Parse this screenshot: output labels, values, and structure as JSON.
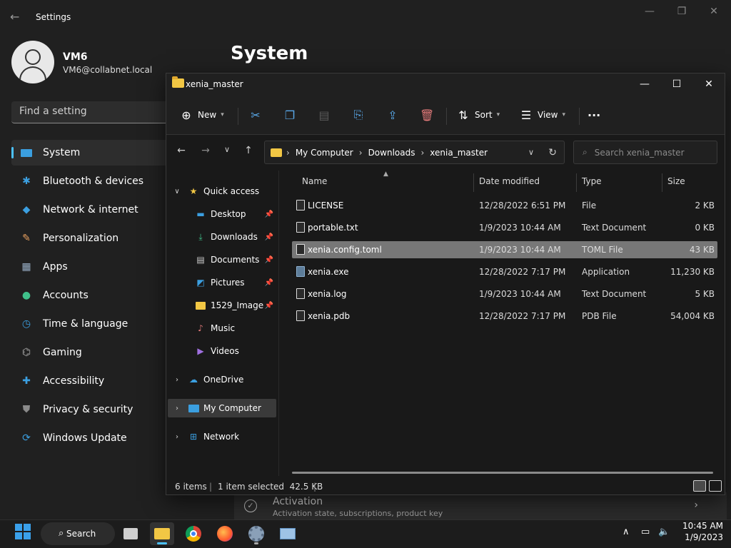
{
  "settings": {
    "title": "Settings",
    "user_name": "VM6",
    "user_email": "VM6@collabnet.local",
    "search_placeholder": "Find a setting",
    "heading": "System",
    "nav": [
      {
        "label": "System",
        "icon": "display-icon",
        "active": true
      },
      {
        "label": "Bluetooth & devices",
        "icon": "bluetooth-icon"
      },
      {
        "label": "Network & internet",
        "icon": "wifi-icon"
      },
      {
        "label": "Personalization",
        "icon": "brush-icon"
      },
      {
        "label": "Apps",
        "icon": "apps-icon"
      },
      {
        "label": "Accounts",
        "icon": "person-icon"
      },
      {
        "label": "Time & language",
        "icon": "clock-globe-icon"
      },
      {
        "label": "Gaming",
        "icon": "gamepad-icon"
      },
      {
        "label": "Accessibility",
        "icon": "accessibility-icon"
      },
      {
        "label": "Privacy & security",
        "icon": "shield-icon"
      },
      {
        "label": "Windows Update",
        "icon": "update-icon"
      }
    ],
    "activation": {
      "title": "Activation",
      "subtitle": "Activation state, subscriptions, product key"
    }
  },
  "explorer": {
    "title": "xenia_master",
    "toolbar": {
      "new_label": "New",
      "sort_label": "Sort",
      "view_label": "View",
      "more_label": "···"
    },
    "breadcrumb": [
      "My Computer",
      "Downloads",
      "xenia_master"
    ],
    "search_placeholder": "Search xenia_master",
    "tree": [
      {
        "label": "Quick access",
        "icon": "star-icon",
        "level": 0,
        "expanded": true
      },
      {
        "label": "Desktop",
        "icon": "desktop-icon",
        "level": 1,
        "pinned": true
      },
      {
        "label": "Downloads",
        "icon": "download-icon",
        "level": 1,
        "pinned": true
      },
      {
        "label": "Documents",
        "icon": "document-icon",
        "level": 1,
        "pinned": true
      },
      {
        "label": "Pictures",
        "icon": "pictures-icon",
        "level": 1,
        "pinned": true
      },
      {
        "label": "1529_Image",
        "icon": "folder-icon",
        "level": 1,
        "pinned": true
      },
      {
        "label": "Music",
        "icon": "music-icon",
        "level": 1
      },
      {
        "label": "Videos",
        "icon": "videos-icon",
        "level": 1
      },
      {
        "label": "OneDrive",
        "icon": "cloud-icon",
        "level": 0,
        "expandable": true
      },
      {
        "label": "My Computer",
        "icon": "computer-icon",
        "level": 0,
        "expandable": true,
        "selected": true
      },
      {
        "label": "Network",
        "icon": "network-icon",
        "level": 0,
        "expandable": true
      }
    ],
    "columns": {
      "name": "Name",
      "date": "Date modified",
      "type": "Type",
      "size": "Size"
    },
    "files": [
      {
        "name": "LICENSE",
        "date": "12/28/2022 6:51 PM",
        "type": "File",
        "size": "2 KB",
        "icon": "file-icon"
      },
      {
        "name": "portable.txt",
        "date": "1/9/2023 10:44 AM",
        "type": "Text Document",
        "size": "0 KB",
        "icon": "text-file-icon"
      },
      {
        "name": "xenia.config.toml",
        "date": "1/9/2023 10:44 AM",
        "type": "TOML File",
        "size": "43 KB",
        "icon": "file-icon",
        "selected": true
      },
      {
        "name": "xenia.exe",
        "date": "12/28/2022 7:17 PM",
        "type": "Application",
        "size": "11,230 KB",
        "icon": "exe-icon"
      },
      {
        "name": "xenia.log",
        "date": "1/9/2023 10:44 AM",
        "type": "Text Document",
        "size": "5 KB",
        "icon": "text-file-icon"
      },
      {
        "name": "xenia.pdb",
        "date": "12/28/2022 7:17 PM",
        "type": "PDB File",
        "size": "54,004 KB",
        "icon": "file-icon"
      }
    ],
    "status": {
      "items": "6 items",
      "selected": "1 item selected  42.5 KB"
    }
  },
  "taskbar": {
    "search_label": "Search",
    "time": "10:45 AM",
    "date": "1/9/2023"
  },
  "colors": {
    "accent": "#4cc2ff",
    "folder": "#f2c744",
    "selection": "#777777"
  }
}
